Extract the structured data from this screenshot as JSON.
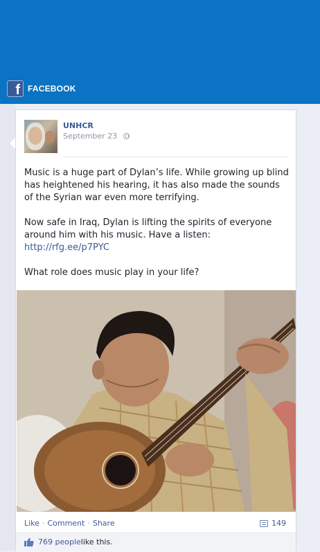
{
  "header": {
    "brand_letter": "f",
    "brand_label": "FACEBOOK",
    "bar_color": "#0a73c3"
  },
  "post": {
    "author": "UNHCR",
    "date": "September 23",
    "paragraphs": [
      "Music is a huge part of Dylan’s life. While growing up blind has heightened his hearing, it has also made the sounds of the Syrian war even more terrifying.",
      "Now safe in Iraq, Dylan is lifting the spirits of everyone around him with his music. Have a listen:"
    ],
    "link": "http://rfg.ee/p7PYC",
    "question": "What role does music play in your life?",
    "photo_alt": "Boy playing a stringed instrument"
  },
  "actions": {
    "like": "Like",
    "comment": "Comment",
    "share": "Share",
    "separator": "·",
    "comment_count": "149"
  },
  "likes": {
    "count_label": "769 people",
    "suffix": " like this."
  },
  "icons": {
    "brand": "facebook-logo-icon",
    "audience": "globe-icon",
    "comments": "comment-icon",
    "likes": "thumbs-up-icon"
  }
}
